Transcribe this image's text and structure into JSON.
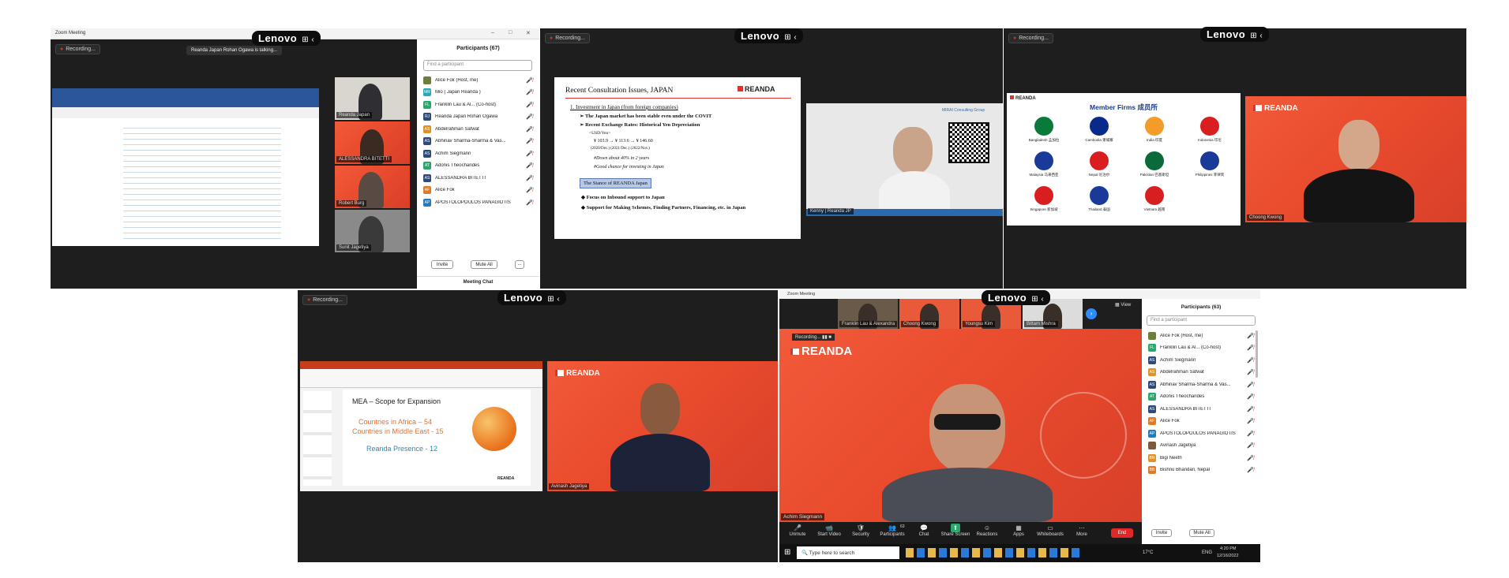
{
  "recording": "Recording...",
  "lenovo": "Lenovo",
  "p1": {
    "app_title": "Zoom Meeting",
    "talking": "Reanda Japan Rohan Ogawa is talking...",
    "thumbs": [
      "Reanda Japan",
      "ALESSANDRA BITETTI",
      "Robert Burg",
      "Sunit Jagetiya"
    ],
    "participants_title": "Participants (67)",
    "search_placeholder": "Find a participant",
    "participants": [
      {
        "initials": "",
        "name": "Alice Fok (Host, me)",
        "color": "#6b7f3a"
      },
      {
        "initials": "MR",
        "name": "Mio ( Japan Reanda )",
        "color": "#2aa7b8"
      },
      {
        "initials": "FL",
        "name": "Franklin Lau & Al... (Co-host)",
        "color": "#2aa76b"
      },
      {
        "initials": "RJ",
        "name": "Reanda Japan Rohan Ogawa",
        "color": "#2d4a7a"
      },
      {
        "initials": "AS",
        "name": "Abdelrahman Safwat",
        "color": "#e0912a"
      },
      {
        "initials": "AS",
        "name": "Abhinav Sharma-Sharma & Vas...",
        "color": "#2d4a7a"
      },
      {
        "initials": "AS",
        "name": "Achim Siegmann",
        "color": "#2d4a7a"
      },
      {
        "initials": "AT",
        "name": "Adonis Theocharides",
        "color": "#2aa76b"
      },
      {
        "initials": "AS",
        "name": "ALESSANDRA BITETTI",
        "color": "#2d4a7a"
      },
      {
        "initials": "AF",
        "name": "Alice Fok",
        "color": "#e07a2a"
      },
      {
        "initials": "AP",
        "name": "APOSTOLOPOULOS PANAGIOTIS",
        "color": "#2a7ab8"
      }
    ],
    "invite": "Invite",
    "mute_all": "Mute All",
    "more": "...",
    "meeting_chat": "Meeting Chat"
  },
  "p2": {
    "slide_title": "Recent Consultation Issues, JAPAN",
    "brand": "REANDA",
    "item1": "1.   Investment in Japan (from foreign companies)",
    "b1": "The Japan market has been stable even under the COVIT",
    "b2": "Recent Exchange Rates: Historical Yen Depreciation",
    "usd": "<USD/Yen>",
    "rates": "¥ 103.9   →   ¥ 113.6   →  ¥ 146.60",
    "years": "(2020/Dec.)        (2021/Dec.)       (2022/Nov.)",
    "down": "#Down about 40% in 2 years",
    "good": "#Good chance for investing in Japan",
    "stance": "The Stance of REANDA Japan",
    "focus": "Focus on Inbound support to Japan",
    "support": "Support for Making Schemes, Finding Partners, Financing, etc. in Japan",
    "cam_name": "Kenny | Reanda JP",
    "mirai": "MIRAI Consulting Group"
  },
  "p3": {
    "brand": "REANDA",
    "heading": "Member Firms 成员所",
    "firms": [
      "Bangladesh 孟加拉",
      "Cambodia 柬埔寨",
      "India 印度",
      "Indonesia 印尼",
      "Malaysia 马来西亚",
      "Nepal 尼泊尔",
      "Pakistan 巴基斯坦",
      "Philippines 菲律宾",
      "Singapore 新加坡",
      "Thailand 泰国",
      "Vietnam 越南"
    ],
    "cam_name": "Choong Kwong"
  },
  "p4": {
    "slide_title": "MEA – Scope for Expansion",
    "l1": "Countries in Africa – 54",
    "l2": "Countries in Middle East - 15",
    "l3": "Reanda Presence - 12",
    "brand": "REANDA",
    "cam_name": "Avinash Jagetiya"
  },
  "p5": {
    "app_title": "Zoom Meeting",
    "view": "View",
    "strip": [
      "Franklin Lau & Alexandra",
      "Choong Kwong",
      "Youngsu Kim",
      "Bittam Mishra"
    ],
    "brand": "REANDA",
    "speaker": "Achim Siegmann",
    "participants_title": "Participants (63)",
    "search_placeholder": "Find a participant",
    "participants": [
      {
        "initials": "",
        "name": "Alice Fok (Host, me)",
        "color": "#6b7f3a"
      },
      {
        "initials": "FL",
        "name": "Franklin Lau & Al... (Co-host)",
        "color": "#2aa76b"
      },
      {
        "initials": "AS",
        "name": "Achim Siegmann",
        "color": "#2d4a7a"
      },
      {
        "initials": "AS",
        "name": "Abdelrahman Safwat",
        "color": "#e0912a"
      },
      {
        "initials": "AS",
        "name": "Abhinav Sharma-Sharma & Vas...",
        "color": "#2d4a7a"
      },
      {
        "initials": "AT",
        "name": "Adonis Theocharides",
        "color": "#2aa76b"
      },
      {
        "initials": "AS",
        "name": "ALESSANDRA BITETTI",
        "color": "#2d4a7a"
      },
      {
        "initials": "AF",
        "name": "Alice Fok",
        "color": "#e07a2a"
      },
      {
        "initials": "AP",
        "name": "APOSTOLOPOULOS PANAGIOTIS",
        "color": "#2a7ab8"
      },
      {
        "initials": "",
        "name": "Avinash Jagetiya",
        "color": "#7a5a3a"
      },
      {
        "initials": "BN",
        "name": "Bigi Neeth",
        "color": "#e0912a"
      },
      {
        "initials": "BB",
        "name": "Bishnu Bhandari, Nepal",
        "color": "#e07a2a"
      }
    ],
    "invite": "Invite",
    "mute_all": "Mute All",
    "toolbar": [
      "Unmute",
      "Start Video",
      "Security",
      "Participants",
      "Chat",
      "Share Screen",
      "Reactions",
      "Apps",
      "Whiteboards",
      "More"
    ],
    "participants_count": "63",
    "end": "End",
    "taskbar_search": "Type here to search",
    "temp": "17°C",
    "lang": "ENG",
    "time": "4:20 PM",
    "date": "12/16/2022"
  }
}
